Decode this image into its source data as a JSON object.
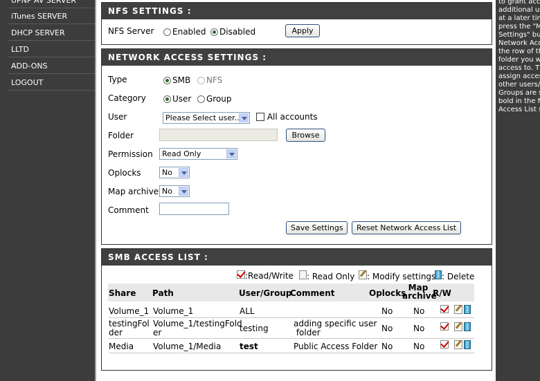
{
  "nav": {
    "items": [
      {
        "label": "UPNP AV SERVER"
      },
      {
        "label": "iTunes SERVER"
      },
      {
        "label": "DHCP SERVER"
      },
      {
        "label": "LLTD"
      },
      {
        "label": "ADD-ONS"
      },
      {
        "label": "LOGOUT"
      }
    ]
  },
  "help": {
    "text": "to grant acc\nadditional us\nat a later tim\npress the \"M\nSettings\" bu\nNetwork Acc\nthe row of th\nfolder you w\naccess to. T\nassign acces\nother users/\nGroups are s\nbold in the N\nAccess List s"
  },
  "nfs": {
    "title": "NFS SETTINGS :",
    "server_label": "NFS Server",
    "enabled_label": "Enabled",
    "disabled_label": "Disabled",
    "selected": "Disabled",
    "apply_label": "Apply"
  },
  "access": {
    "title": "NETWORK ACCESS SETTINGS :",
    "type_label": "Type",
    "type_smb": "SMB",
    "type_nfs": "NFS",
    "type_selected": "SMB",
    "category_label": "Category",
    "category_user": "User",
    "category_group": "Group",
    "category_selected": "User",
    "user_label": "User",
    "user_value": "Please Select user...",
    "all_accounts_label": "All accounts",
    "all_accounts_checked": false,
    "folder_label": "Folder",
    "folder_value": "",
    "browse_label": "Browse",
    "permission_label": "Permission",
    "permission_value": "Read Only",
    "oplocks_label": "Oplocks",
    "oplocks_value": "No",
    "map_archive_label": "Map archive",
    "map_archive_value": "No",
    "comment_label": "Comment",
    "comment_value": "",
    "save_label": "Save Settings",
    "reset_label": "Reset Network Access List"
  },
  "smb": {
    "title": "SMB ACCESS LIST :",
    "legend": {
      "read_write": ":Read/Write",
      "read_only": ": Read Only",
      "modify": ": Modify settings",
      "delete": ": Delete"
    },
    "headers": {
      "share": "Share",
      "path": "Path",
      "user_group": "User/Group",
      "comment": "Comment",
      "oplocks": "Oplocks",
      "map_archive_1": "Map",
      "map_archive_2": "archive",
      "rw": "R/W"
    },
    "rows": [
      {
        "share": "Volume_1",
        "path": "Volume_1",
        "user": "ALL",
        "comment": "",
        "oplocks": "No",
        "map_archive": "No",
        "user_bold": false
      },
      {
        "share": "testingFol\nder",
        "path": "Volume_1/testingFold\ner",
        "user": "testing",
        "comment": "adding specific user\n folder",
        "oplocks": "No",
        "map_archive": "No",
        "user_bold": false
      },
      {
        "share": "Media",
        "path": "Volume_1/Media",
        "user": "test",
        "comment": "Public Access Folder",
        "oplocks": "No",
        "map_archive": "No",
        "user_bold": true
      }
    ]
  }
}
